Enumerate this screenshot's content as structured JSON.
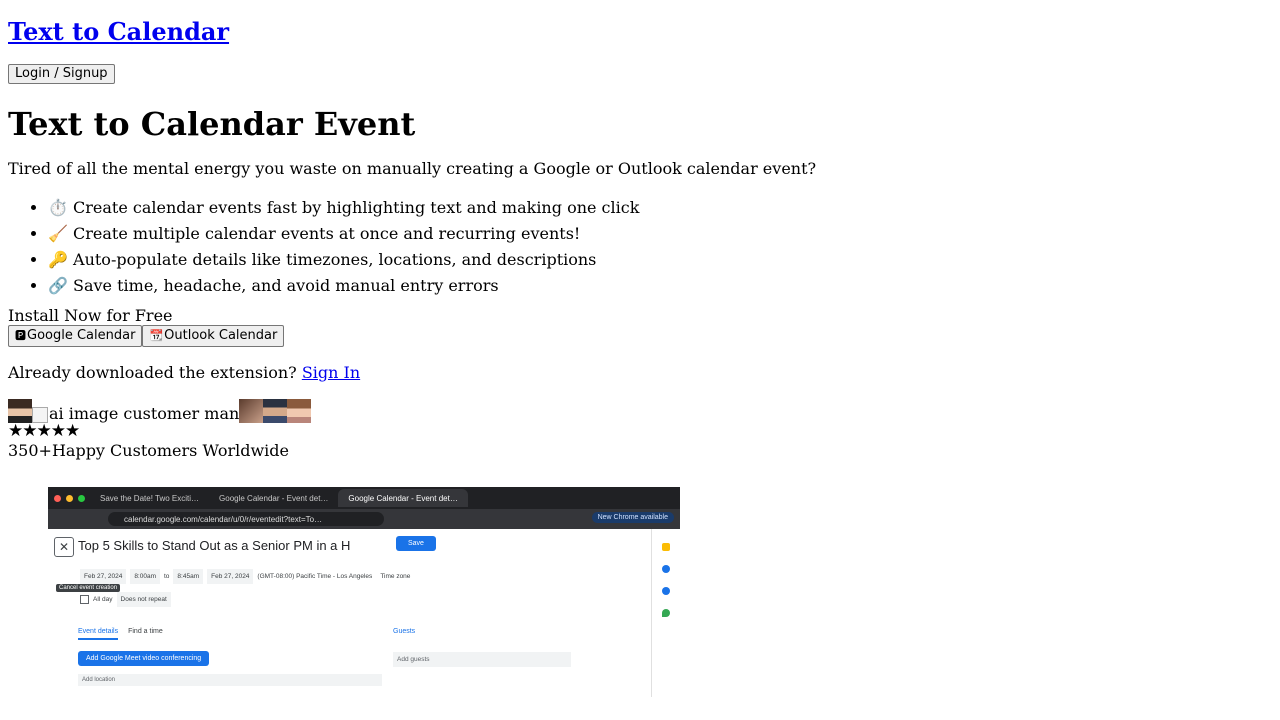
{
  "header": {
    "brand": "Text to Calendar",
    "login_label": "Login / Signup"
  },
  "hero": {
    "title": "Text to Calendar Event",
    "lede": "Tired of all the mental energy you waste on manually creating a Google or Outlook calendar event?",
    "features": [
      {
        "emoji": "⏱️",
        "text": "Create calendar events fast by highlighting text and making one click"
      },
      {
        "emoji": "🧹",
        "text": "Create multiple calendar events at once and recurring events!"
      },
      {
        "emoji": "🔑",
        "text": "Auto-populate details like timezones, locations, and descriptions"
      },
      {
        "emoji": "🔗",
        "text": "Save time, headache, and avoid manual entry errors"
      }
    ],
    "install_label": "Install Now for Free",
    "google_label": "Google Calendar",
    "outlook_label": "Outlook Calendar",
    "signin_prefix": "Already downloaded the extension? ",
    "signin_link": "Sign In",
    "broken_img_alt": "ai image customer man",
    "stars": "★★★★★",
    "customers_count": "350+",
    "customers_label": "Happy Customers Worldwide"
  },
  "screenshot": {
    "tabs": [
      "Save the Date! Two Exciti…",
      "Google Calendar - Event det…",
      "Google Calendar - Event det…"
    ],
    "url": "calendar.google.com/calendar/u/0/r/eventedit?text=To…",
    "new_chrome": "New Chrome available",
    "event_title": "Top 5 Skills to Stand Out as a Senior PM in a H",
    "save_label": "Save",
    "cancel_tooltip": "Cancel event creation",
    "start_date": "Feb 27, 2024",
    "start_time": "8:00am",
    "to_label": "to",
    "end_time": "8:45am",
    "end_date": "Feb 27, 2024",
    "timezone_text": "(GMT-08:00) Pacific Time - Los Angeles",
    "timezone_link": "Time zone",
    "all_day": "All day",
    "repeat": "Does not repeat",
    "tab_details": "Event details",
    "tab_find": "Find a time",
    "guests_label": "Guests",
    "meet_label": "Add Google Meet video conferencing",
    "add_guests": "Add guests",
    "add_location": "Add location"
  }
}
